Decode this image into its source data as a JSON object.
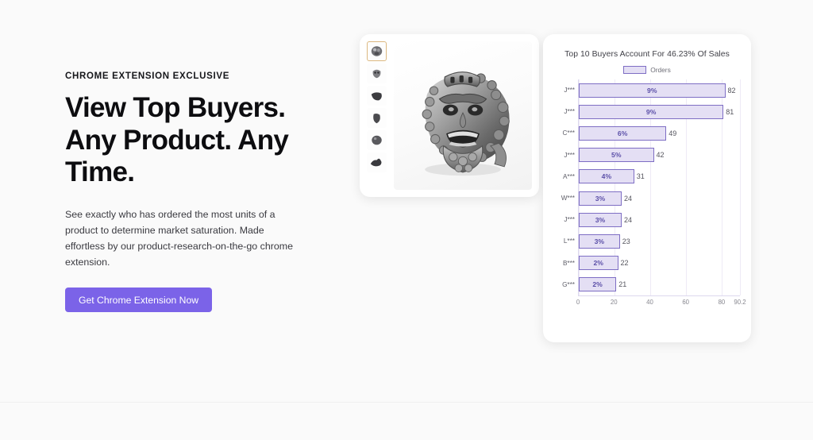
{
  "theme": {
    "page_bg": "#fafafa",
    "accent": "#7b63e8",
    "bar_fill": "#e4dff4",
    "bar_stroke": "#7e6ec4",
    "thumb_selected_border": "#dcb880"
  },
  "hero": {
    "eyebrow": "CHROME EXTENSION EXCLUSIVE",
    "headline": "View Top Buyers. Any Product. Any Time.",
    "body": "See exactly who has ordered the most units of a product to determine market saturation. Made effortless by our product-research-on-the-go chrome extension.",
    "cta_label": "Get Chrome Extension Now"
  },
  "product": {
    "main_image_alt": "silver bearded warrior head ring",
    "thumbnails": [
      {
        "name": "thumbnail-1",
        "selected": true
      },
      {
        "name": "thumbnail-2",
        "selected": false
      },
      {
        "name": "thumbnail-3",
        "selected": false
      },
      {
        "name": "thumbnail-4",
        "selected": false
      },
      {
        "name": "thumbnail-5",
        "selected": false
      },
      {
        "name": "thumbnail-6",
        "selected": false
      }
    ]
  },
  "chart_data": {
    "type": "bar",
    "orientation": "horizontal",
    "title": "Top 10 Buyers Account For 46.23% Of Sales",
    "legend": {
      "entries": [
        "Orders"
      ],
      "position": "top-center"
    },
    "xlabel": "",
    "ylabel": "",
    "xlim": [
      0,
      90.2
    ],
    "ticks": [
      "0",
      "20",
      "40",
      "60",
      "80",
      "90.2"
    ],
    "tick_values": [
      0,
      20,
      40,
      60,
      80,
      90.2
    ],
    "grid": true,
    "categories": [
      "J***",
      "J***",
      "C***",
      "J***",
      "A***",
      "W***",
      "J***",
      "L***",
      "B***",
      "G***"
    ],
    "values": [
      82,
      81,
      49,
      42,
      31,
      24,
      24,
      23,
      22,
      21
    ],
    "percent_labels": [
      "9%",
      "9%",
      "6%",
      "5%",
      "4%",
      "3%",
      "3%",
      "3%",
      "2%",
      "2%"
    ],
    "value_labels": [
      "82",
      "81",
      "49",
      "42",
      "31",
      "24",
      "24",
      "23",
      "22",
      "21"
    ],
    "series": [
      {
        "name": "Orders",
        "values": [
          82,
          81,
          49,
          42,
          31,
          24,
          24,
          23,
          22,
          21
        ]
      }
    ]
  }
}
